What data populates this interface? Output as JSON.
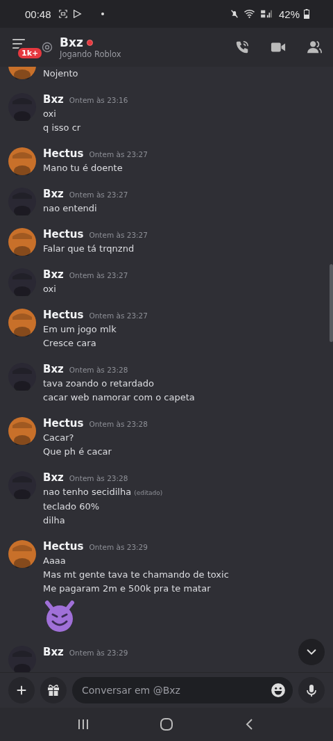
{
  "status_bar": {
    "time": "00:48",
    "battery": "42%"
  },
  "header": {
    "badge": "1k+",
    "name": "Bxz",
    "dnd": true,
    "activity": "Jogando Roblox"
  },
  "messages": [
    {
      "color": "#c8702a",
      "lines": [
        {
          "kind": "text",
          "text": "Nojento"
        }
      ]
    },
    {
      "author": "Bxz",
      "time": "Ontem às 23:16",
      "color": "#2a2833",
      "lines": [
        {
          "kind": "text",
          "text": "oxi"
        },
        {
          "kind": "text",
          "text": "q isso cr"
        }
      ]
    },
    {
      "author": "Hectus",
      "time": "Ontem às 23:27",
      "color": "#c8702a",
      "lines": [
        {
          "kind": "text",
          "text": "Mano tu é doente"
        }
      ]
    },
    {
      "author": "Bxz",
      "time": "Ontem às 23:27",
      "color": "#2a2833",
      "lines": [
        {
          "kind": "text",
          "text": "nao entendi"
        }
      ]
    },
    {
      "author": "Hectus",
      "time": "Ontem às 23:27",
      "color": "#c8702a",
      "lines": [
        {
          "kind": "text",
          "text": "Falar que tá trqnznd"
        }
      ]
    },
    {
      "author": "Bxz",
      "time": "Ontem às 23:27",
      "color": "#2a2833",
      "lines": [
        {
          "kind": "text",
          "text": "oxi"
        }
      ]
    },
    {
      "author": "Hectus",
      "time": "Ontem às 23:27",
      "color": "#c8702a",
      "lines": [
        {
          "kind": "text",
          "text": "Em um jogo mlk"
        },
        {
          "kind": "text",
          "text": "Cresce cara"
        }
      ]
    },
    {
      "author": "Bxz",
      "time": "Ontem às 23:28",
      "color": "#2a2833",
      "lines": [
        {
          "kind": "text",
          "text": "tava zoando o retardado"
        },
        {
          "kind": "text",
          "text": "cacar web namorar com  o capeta"
        }
      ]
    },
    {
      "author": "Hectus",
      "time": "Ontem às 23:28",
      "color": "#c8702a",
      "lines": [
        {
          "kind": "text",
          "text": "Cacar?"
        },
        {
          "kind": "text",
          "text": "Que ph é cacar"
        }
      ]
    },
    {
      "author": "Bxz",
      "time": "Ontem às 23:28",
      "color": "#2a2833",
      "lines": [
        {
          "kind": "text",
          "text": "nao tenho secidilha",
          "edited": "(editado)"
        },
        {
          "kind": "text",
          "text": "teclado 60%"
        },
        {
          "kind": "text",
          "text": "dilha"
        }
      ]
    },
    {
      "author": "Hectus",
      "time": "Ontem às 23:29",
      "color": "#c8702a",
      "lines": [
        {
          "kind": "text",
          "text": "Aaaa"
        },
        {
          "kind": "text",
          "text": "Mas mt gente tava te chamando de toxic"
        },
        {
          "kind": "text",
          "text": "Me pagaram 2m e 500k pra te matar"
        },
        {
          "kind": "emoji"
        }
      ]
    },
    {
      "author": "Bxz",
      "time": "Ontem às 23:29",
      "color": "#2a2833"
    }
  ],
  "composer": {
    "placeholder": "Conversar em @Bxz"
  }
}
